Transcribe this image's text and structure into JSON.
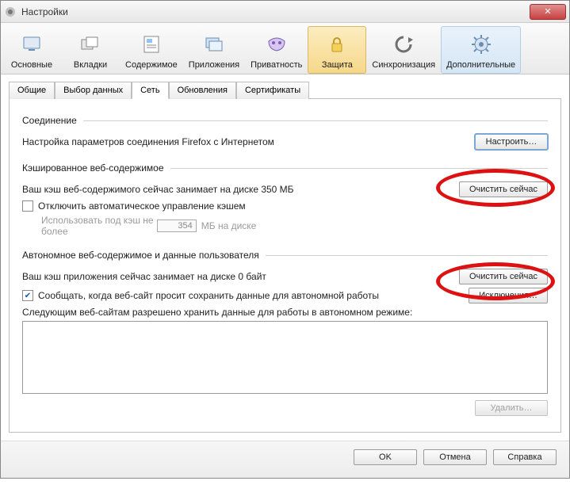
{
  "window": {
    "title": "Настройки"
  },
  "toolbar": {
    "items": [
      {
        "label": "Основные",
        "icon": "monitor"
      },
      {
        "label": "Вкладки",
        "icon": "tabs"
      },
      {
        "label": "Содержимое",
        "icon": "content"
      },
      {
        "label": "Приложения",
        "icon": "apps"
      },
      {
        "label": "Приватность",
        "icon": "mask"
      },
      {
        "label": "Защита",
        "icon": "lock"
      },
      {
        "label": "Синхронизация",
        "icon": "sync"
      },
      {
        "label": "Дополнительные",
        "icon": "gear"
      }
    ]
  },
  "subtabs": {
    "items": [
      "Общие",
      "Выбор данных",
      "Сеть",
      "Обновления",
      "Сертификаты"
    ],
    "active": "Сеть"
  },
  "sections": {
    "connection": {
      "title": "Соединение",
      "text": "Настройка параметров соединения Firefox с Интернетом",
      "button": "Настроить…"
    },
    "cache": {
      "title": "Кэшированное веб-содержимое",
      "text": "Ваш кэш веб-содержимого сейчас занимает на диске 350 МБ",
      "button": "Очистить сейчас",
      "disable_auto": "Отключить автоматическое управление кэшем",
      "limit_prefix": "Использовать под кэш не более",
      "limit_value": "354",
      "limit_suffix": "МБ на диске"
    },
    "offline": {
      "title": "Автономное веб-содержимое и данные пользователя",
      "text": "Ваш кэш приложения сейчас занимает на диске 0 байт",
      "button": "Очистить сейчас",
      "notify": "Сообщать, когда веб-сайт просит сохранить данные для автономной работы",
      "exceptions": "Исключения…",
      "allowed_label": "Следующим веб-сайтам разрешено хранить данные для работы в автономном режиме:",
      "delete": "Удалить…"
    }
  },
  "footer": {
    "ok": "OK",
    "cancel": "Отмена",
    "help": "Справка"
  }
}
